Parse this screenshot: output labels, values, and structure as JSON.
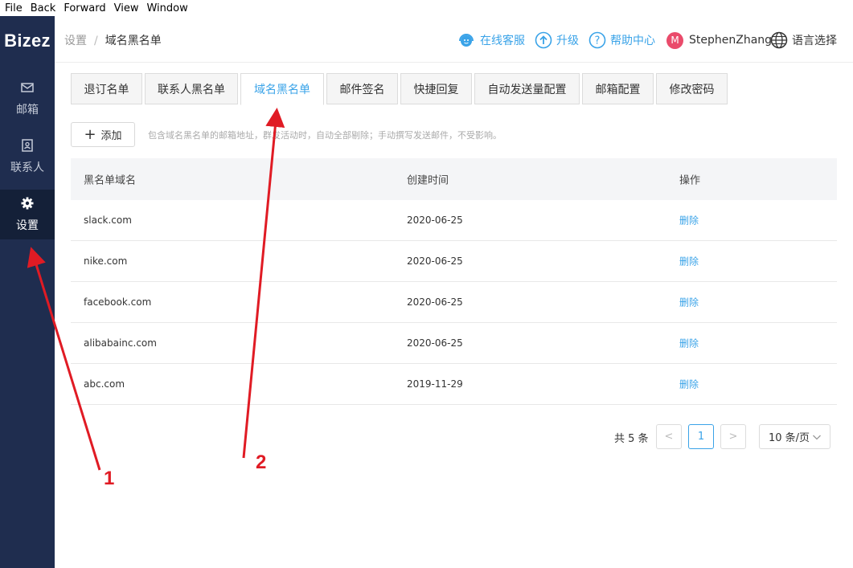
{
  "menubar": {
    "items": [
      "File",
      "Back",
      "Forward",
      "View",
      "Window"
    ]
  },
  "sidebar": {
    "logo": "Bizez",
    "items": [
      {
        "label": "邮箱",
        "icon": "mail-icon"
      },
      {
        "label": "联系人",
        "icon": "contact-book-icon"
      },
      {
        "label": "设置",
        "icon": "gear-icon",
        "active": true
      }
    ]
  },
  "topbar": {
    "breadcrumb": {
      "parent": "设置",
      "separator": "/",
      "current": "域名黑名单"
    },
    "support": "在线客服",
    "upgrade": "升级",
    "help": "帮助中心",
    "avatar_letter": "M",
    "username": "StephenZhang",
    "language": "语言选择"
  },
  "tabs": [
    "退订名单",
    "联系人黑名单",
    "域名黑名单",
    "邮件签名",
    "快捷回复",
    "自动发送量配置",
    "邮箱配置",
    "修改密码"
  ],
  "active_tab": "域名黑名单",
  "toolbar": {
    "add_label": "添加",
    "hint": "包含域名黑名单的邮箱地址，群发活动时，自动全部剔除；手动撰写发送邮件，不受影响。"
  },
  "table": {
    "headers": [
      "黑名单域名",
      "创建时间",
      "操作"
    ],
    "rows": [
      {
        "domain": "slack.com",
        "date": "2020-06-25",
        "action": "删除"
      },
      {
        "domain": "nike.com",
        "date": "2020-06-25",
        "action": "删除"
      },
      {
        "domain": "facebook.com",
        "date": "2020-06-25",
        "action": "删除"
      },
      {
        "domain": "alibabainc.com",
        "date": "2020-06-25",
        "action": "删除"
      },
      {
        "domain": "abc.com",
        "date": "2019-11-29",
        "action": "删除"
      }
    ]
  },
  "pagination": {
    "total": "共 5 条",
    "prev": "<",
    "current": "1",
    "next": ">",
    "page_size": "10 条/页"
  },
  "annotations": {
    "arrow1": "1",
    "arrow2": "2"
  },
  "colors": {
    "sidebar": "#1f2d4f",
    "accent": "#3aa3e8",
    "annotation": "#e01b24"
  }
}
